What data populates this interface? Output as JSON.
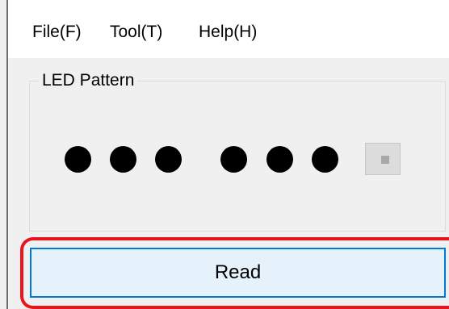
{
  "menu": {
    "file": "File(F)",
    "tool": "Tool(T)",
    "help": "Help(H)"
  },
  "led_pattern": {
    "title": "LED Pattern",
    "leds": [
      {
        "name": "led-1",
        "state": "on"
      },
      {
        "name": "led-2",
        "state": "on"
      },
      {
        "name": "led-3",
        "state": "on"
      },
      {
        "name": "led-4",
        "state": "on"
      },
      {
        "name": "led-5",
        "state": "on"
      },
      {
        "name": "led-6",
        "state": "on"
      }
    ],
    "stop_icon": "stop-icon"
  },
  "actions": {
    "read_label": "Read"
  },
  "colors": {
    "led_on": "#000000",
    "highlight": "#e8141e",
    "focus_border": "#0078d7",
    "button_bg": "#e5f1fb"
  }
}
